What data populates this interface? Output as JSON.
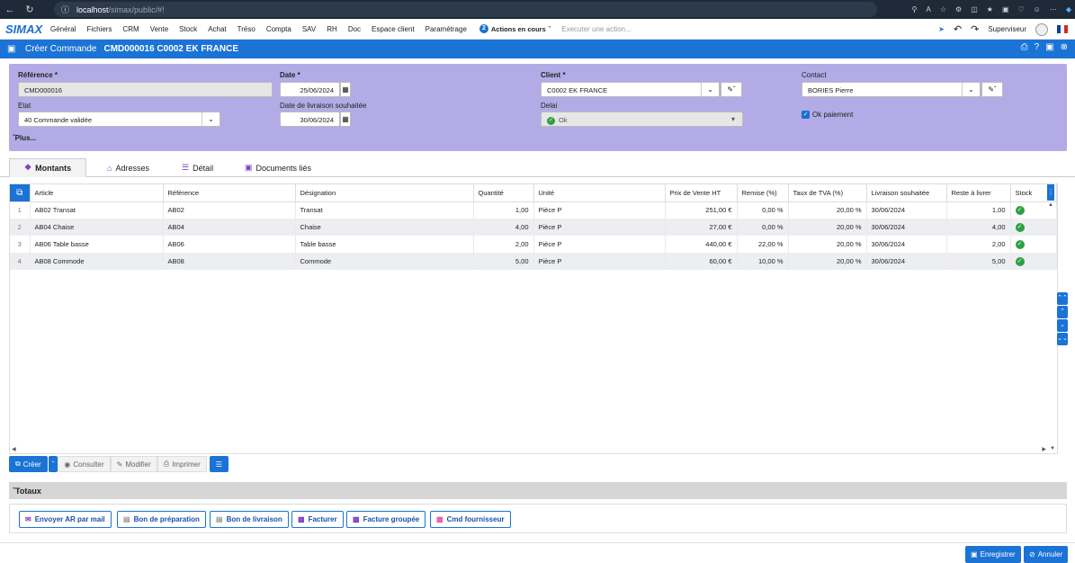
{
  "browser": {
    "url_host": "localhost",
    "url_path": "/simax/public/#!"
  },
  "nav": {
    "logo": "SIMAX",
    "menu": [
      "Général",
      "Fichiers",
      "CRM",
      "Vente",
      "Stock",
      "Achat",
      "Tréso",
      "Compta",
      "SAV",
      "RH",
      "Doc",
      "Espace client",
      "Paramétrage"
    ],
    "actions_count": "2",
    "actions_label": "Actions en cours",
    "execute_placeholder": "Executer une action...",
    "user": "Superviseur"
  },
  "title": {
    "label": "Créer Commande",
    "doc": "CMD000016 C0002 EK FRANCE"
  },
  "form": {
    "reference_label": "Référence *",
    "reference_value": "CMD000016",
    "date_label": "Date *",
    "date_value": "25/06/2024",
    "client_label": "Client *",
    "client_value": "C0002 EK FRANCE",
    "contact_label": "Contact",
    "contact_value": "BORIES Pierre",
    "etat_label": "Etat",
    "etat_value": "40 Commande validée",
    "livraison_label": "Date de livraison souhaitée",
    "livraison_value": "30/06/2024",
    "delai_label": "Delai",
    "delai_value": "Ok",
    "ok_paiement_label": "Ok paiement",
    "plus_label": "Plus..."
  },
  "tabs": [
    "Montants",
    "Adresses",
    "Détail",
    "Documents liés"
  ],
  "grid": {
    "headers": [
      "Article",
      "Référence",
      "Désignation",
      "Quantité",
      "Unité",
      "Prix de Vente HT",
      "Remise (%)",
      "Taux de TVA (%)",
      "Livraison souhaitée",
      "Reste à livrer",
      "Stock"
    ],
    "rows": [
      {
        "idx": "1",
        "article": "AB02 Transat",
        "ref": "AB02",
        "designation": "Transat",
        "qty": "1,00",
        "unite": "Pièce P",
        "prix": "251,00 €",
        "remise": "0,00 %",
        "tva": "20,00 %",
        "livraison": "30/06/2024",
        "reste": "1,00"
      },
      {
        "idx": "2",
        "article": "AB04 Chaise",
        "ref": "AB04",
        "designation": "Chaise",
        "qty": "4,00",
        "unite": "Pièce P",
        "prix": "27,00 €",
        "remise": "0,00 %",
        "tva": "20,00 %",
        "livraison": "30/06/2024",
        "reste": "4,00"
      },
      {
        "idx": "3",
        "article": "AB06 Table basse",
        "ref": "AB06",
        "designation": "Table basse",
        "qty": "2,00",
        "unite": "Pièce P",
        "prix": "440,00 €",
        "remise": "22,00 %",
        "tva": "20,00 %",
        "livraison": "30/06/2024",
        "reste": "2,00"
      },
      {
        "idx": "4",
        "article": "AB08 Commode",
        "ref": "AB08",
        "designation": "Commode",
        "qty": "5,00",
        "unite": "Pièce P",
        "prix": "60,00 €",
        "remise": "10,00 %",
        "tva": "20,00 %",
        "livraison": "30/06/2024",
        "reste": "5,00"
      }
    ]
  },
  "toolbar": {
    "create": "Créer",
    "consult": "Consulter",
    "modify": "Modifier",
    "print": "Imprimer"
  },
  "totals_label": "Totaux",
  "actions": [
    "Envoyer AR par mail",
    "Bon de préparation",
    "Bon de livraison",
    "Facturer",
    "Facture groupée",
    "Cmd fournisseur"
  ],
  "footer": {
    "save": "Enregistrer",
    "cancel": "Annuler"
  }
}
